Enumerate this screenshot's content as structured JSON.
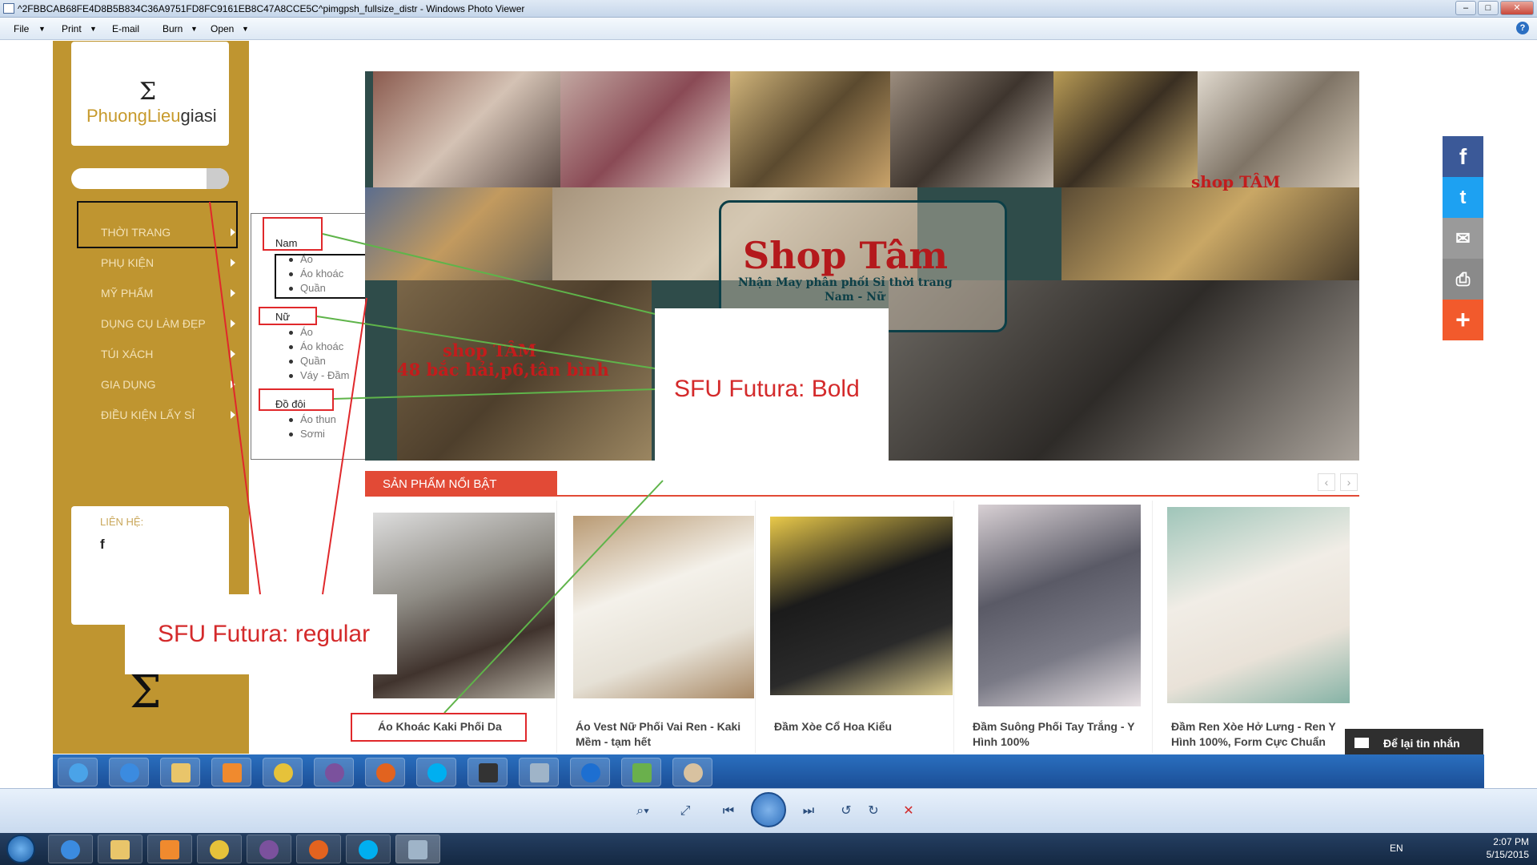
{
  "window": {
    "title": "^2FBBCAB68FE4D8B5B834C36A9751FD8FC9161EB8C47A8CCE5C^pimgpsh_fullsize_distr - Windows Photo Viewer",
    "buttons": [
      "–",
      "□",
      "✕"
    ]
  },
  "menubar": {
    "items": [
      "File",
      "Print",
      "E-mail",
      "Burn",
      "Open"
    ],
    "help_label": "?"
  },
  "site": {
    "logo": {
      "glyph": "Σ",
      "text_brand": "PhuongLieu",
      "text_rest": "giasi"
    },
    "nav": [
      {
        "label": "THỜI TRANG"
      },
      {
        "label": "PHỤ KIỆN"
      },
      {
        "label": "MỸ PHẨM"
      },
      {
        "label": "DỤNG CỤ LÀM ĐẸP"
      },
      {
        "label": "TÚI XÁCH"
      },
      {
        "label": "GIA DỤNG"
      },
      {
        "label": "ĐIỀU KIỆN LẤY SỈ"
      }
    ],
    "submenu": {
      "groups": [
        {
          "label": "Nam",
          "items": [
            "Áo",
            "Áo khoác",
            "Quần"
          ]
        },
        {
          "label": "Nữ",
          "items": [
            "Áo",
            "Áo khoác",
            "Quần",
            "Váy - Đầm"
          ]
        },
        {
          "label": "Đồ đôi",
          "items": [
            "Áo thun",
            "Sơmi"
          ]
        }
      ]
    },
    "contact": {
      "label": "LIÊN HỆ:",
      "facebook": "f"
    },
    "banner": {
      "title": "Shop Tâm",
      "subtitle1": "Nhận May phân phối Sỉ thời trang",
      "subtitle2": "Nam - Nữ",
      "watermark_right": "shop TÂM",
      "watermark_left1": "shop TÂM",
      "watermark_left2": "48 bắc hải,p6,tân bình"
    },
    "featured": {
      "title": "SẢN PHẨM NỔI BẬT",
      "prev": "‹",
      "next": "›",
      "products": [
        {
          "name_lines": [
            "Áo Khoác Kaki Phối Da"
          ]
        },
        {
          "name_lines": [
            "Áo Vest Nữ Phối Vai Ren - Kaki",
            "Mềm - tạm hết"
          ]
        },
        {
          "name_lines": [
            "Đầm Xòe Cổ Hoa Kiểu"
          ]
        },
        {
          "name_lines": [
            "Đầm Suông Phối Tay Trắng - Y",
            "Hình 100%"
          ]
        },
        {
          "name_lines": [
            "Đầm Ren Xòe Hở Lưng - Ren Y",
            "Hình 100%, Form Cực Chuẩn"
          ]
        }
      ]
    },
    "social": [
      {
        "icon": "facebook-icon",
        "glyph": "f",
        "color": "#3b5998"
      },
      {
        "icon": "twitter-icon",
        "glyph": "t",
        "color": "#1da1f2"
      },
      {
        "icon": "email-icon",
        "glyph": "✉",
        "color": "#9a9a9a"
      },
      {
        "icon": "print-icon",
        "glyph": "⎙",
        "color": "#8a8a8a"
      },
      {
        "icon": "plus-icon",
        "glyph": "+",
        "color": "#f25a2c"
      }
    ],
    "message_bar": "Để lại tin nhắn"
  },
  "annotations": {
    "bold": "SFU Futura: Bold",
    "regular": "SFU Futura: regular"
  },
  "viewer_controls": [
    "⌕▾",
    "⤢",
    "⏮",
    "⏭",
    "↺",
    "↻",
    "✕"
  ],
  "tray": {
    "lang": "EN",
    "time": "2:07 PM",
    "date": "5/15/2015"
  },
  "colors": {
    "gold": "#bf9530",
    "accent_red": "#e24a36",
    "annotation_red": "#d42a2b"
  }
}
